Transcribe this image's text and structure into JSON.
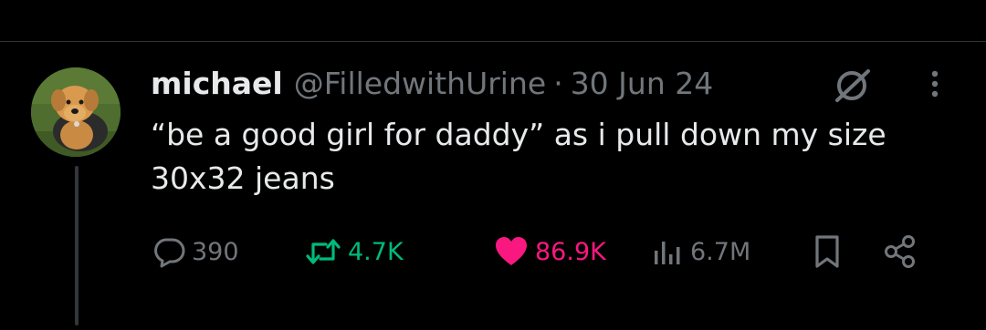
{
  "post": {
    "author": {
      "display_name": "michael",
      "handle": "@FilledwithUrine",
      "avatar": "avatar-plush-dog"
    },
    "separator": "·",
    "date": "30 Jun 24",
    "text": "“be a good girl for daddy” as i pull down my size 30x32 jeans",
    "header_icons": [
      "grok-icon",
      "more-icon"
    ],
    "actions": {
      "replies": "390",
      "reposts": "4.7K",
      "likes": "86.9K",
      "views": "6.7M"
    },
    "action_icons": [
      "reply-icon",
      "repost-icon",
      "like-icon",
      "views-icon",
      "bookmark-icon",
      "share-icon"
    ]
  },
  "colors": {
    "background": "#000000",
    "text_primary": "#e7e9ea",
    "text_secondary": "#71767b",
    "repost_active": "#00ba7c",
    "like_active": "#f91880",
    "divider": "#2f3336"
  }
}
